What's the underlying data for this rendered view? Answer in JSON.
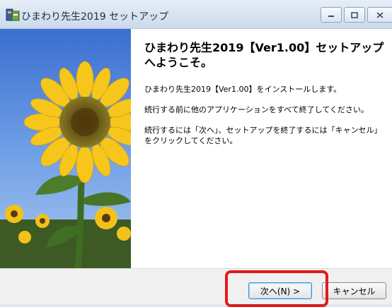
{
  "window": {
    "title": "ひまわり先生2019 セットアップ",
    "icon": "installer-app-icon"
  },
  "titlebar_buttons": [
    "minimize-icon",
    "maximize-icon",
    "close-icon"
  ],
  "content": {
    "heading": "ひまわり先生2019【Ver1.00】セットアップへようこそ。",
    "paragraphs": [
      "ひまわり先生2019【Ver1.00】をインストールします。",
      "続行する前に他のアプリケーションをすべて終了してください。",
      "続行するには「次へ」、セットアップを終了するには「キャンセル」をクリックしてください。"
    ]
  },
  "buttons": {
    "next": "次へ(N) >",
    "cancel": "キャンセル"
  },
  "colors": {
    "highlight": "#e21a1a",
    "titlebar": "#d6e2f0"
  }
}
